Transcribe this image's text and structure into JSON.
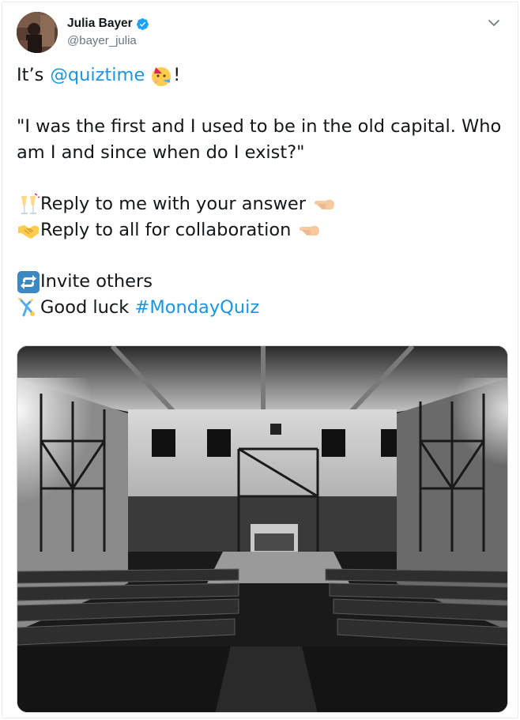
{
  "user": {
    "display_name": "Julia Bayer",
    "handle": "@bayer_julia",
    "verified": true
  },
  "tweet": {
    "line1_prefix": "It’s ",
    "line1_mention": "@quiztime",
    "line1_emoji": "party-face-emoji",
    "line1_suffix": "!",
    "quote_line1": "\"I was the first and I used to be in the old capital. Who",
    "quote_line2": "am I and since when do I exist?\"",
    "line_reply_me": "Reply to me with your answer",
    "line_reply_all": "Reply to all for collaboration",
    "line_invite": "Invite others",
    "line_luck_prefix": "Good luck ",
    "hashtag": "#MondayQuiz"
  },
  "icons": {
    "verified": "verified-badge-icon",
    "caret": "chevron-down-icon",
    "champagne": "clinking-glasses-emoji",
    "handshake": "handshake-emoji",
    "pointing": "backhand-pointing-left-emoji",
    "repeat": "repeat-arrows-emoji",
    "cartwheel": "person-cartwheeling-emoji"
  },
  "colors": {
    "link": "#1b95e0",
    "verified": "#1da1f2",
    "text": "#14171a",
    "secondary": "#657786"
  },
  "media": {
    "description_icon": "photo-of-old-hall-with-scaffolding"
  }
}
